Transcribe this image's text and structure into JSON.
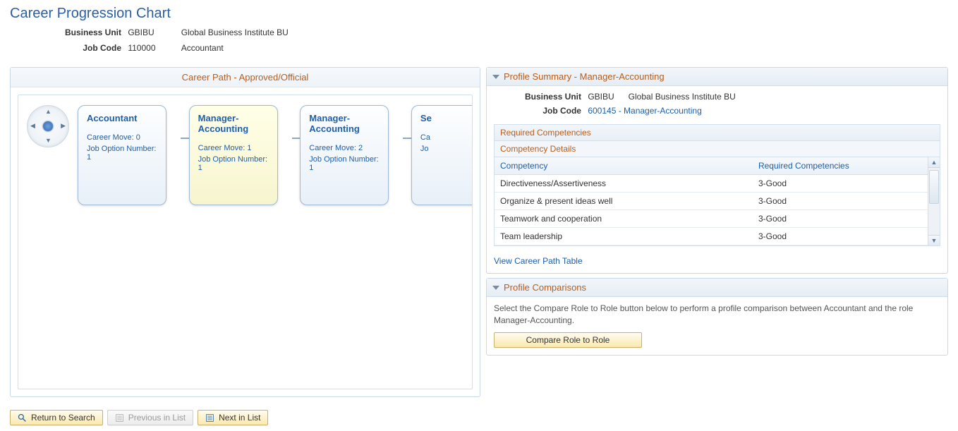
{
  "page_title": "Career Progression Chart",
  "header": {
    "labels": {
      "bu": "Business Unit",
      "jc": "Job Code"
    },
    "business_unit_code": "GBIBU",
    "business_unit_name": "Global Business Institute BU",
    "job_code": "110000",
    "job_title": "Accountant"
  },
  "career_path": {
    "title": "Career Path - Approved/Official",
    "labels": {
      "career_move": "Career Move:",
      "job_option": "Job Option Number:"
    },
    "nodes": [
      {
        "title": "Accountant",
        "career_move": "0",
        "job_option": "1",
        "selected": false
      },
      {
        "title": "Manager-Accounting",
        "career_move": "1",
        "job_option": "1",
        "selected": true
      },
      {
        "title": "Manager-Accounting",
        "career_move": "2",
        "job_option": "1",
        "selected": false
      },
      {
        "title": "Se",
        "career_move": "",
        "job_option": "",
        "selected": false,
        "clipped": true
      }
    ]
  },
  "profile_summary": {
    "title": "Profile Summary - Manager-Accounting",
    "labels": {
      "bu": "Business Unit",
      "jc": "Job Code"
    },
    "business_unit_code": "GBIBU",
    "business_unit_name": "Global Business Institute BU",
    "job_code_link": "600145 - Manager-Accounting",
    "required_competencies_header": "Required Competencies",
    "competency_details_header": "Competency Details",
    "table": {
      "columns": {
        "competency": "Competency",
        "required": "Required Competencies"
      },
      "rows": [
        {
          "competency": "Directiveness/Assertiveness",
          "required": "3-Good"
        },
        {
          "competency": "Organize & present ideas well",
          "required": "3-Good"
        },
        {
          "competency": "Teamwork and cooperation",
          "required": "3-Good"
        },
        {
          "competency": "Team leadership",
          "required": "3-Good"
        }
      ]
    },
    "view_table_link": "View Career Path Table"
  },
  "profile_comparisons": {
    "title": "Profile Comparisons",
    "text": "Select the Compare Role to Role button below to perform a profile comparison between Accountant and the role Manager-Accounting.",
    "button": "Compare Role to Role"
  },
  "footer": {
    "return": "Return to Search",
    "prev": "Previous in List",
    "next": "Next in List"
  }
}
